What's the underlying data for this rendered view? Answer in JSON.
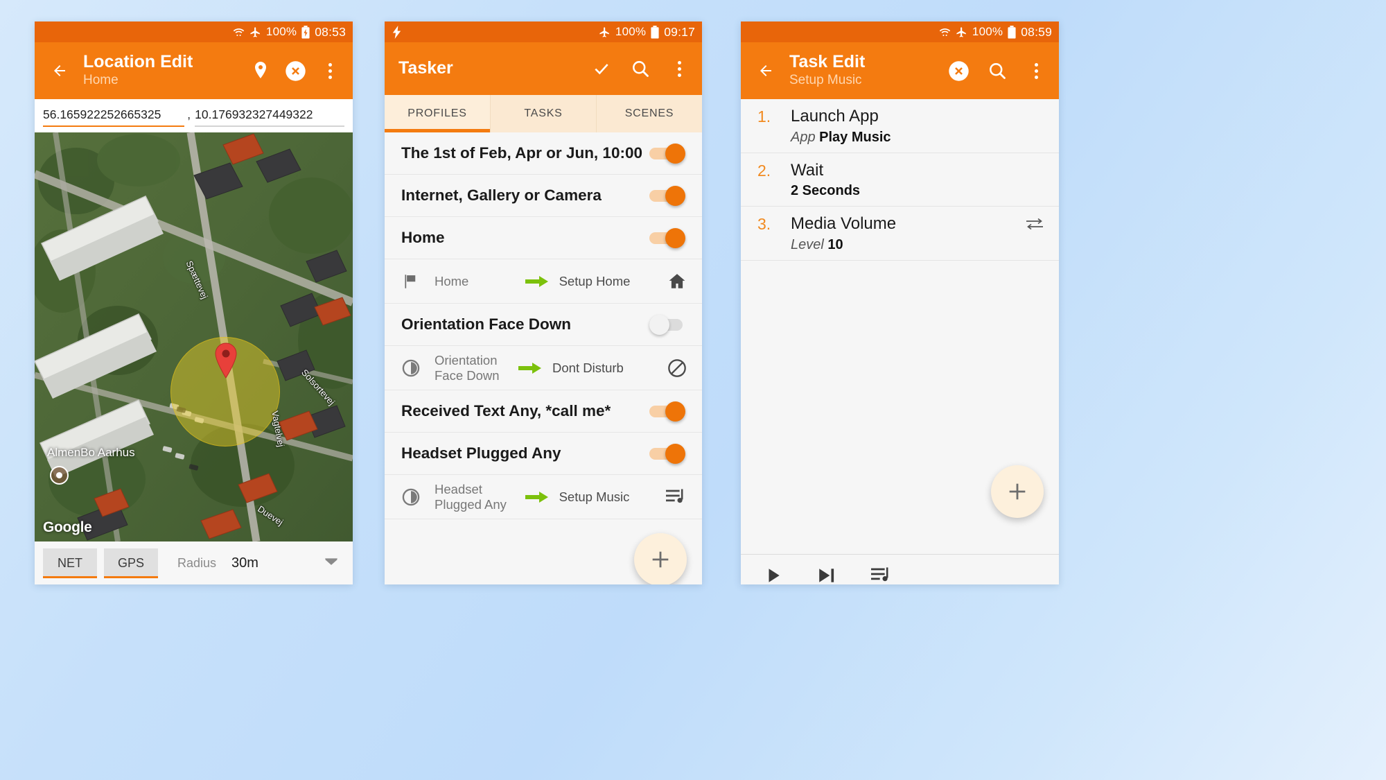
{
  "background": {
    "color_from": "#d6e9fb",
    "color_to": "#e4f0fd"
  },
  "theme": {
    "accent": "#f47b10",
    "statusbar": "#e8650a",
    "tabbar": "#fbe9d2",
    "green_arrow": "#7cc10c",
    "number_orange": "#f18a20"
  },
  "phone1": {
    "status": {
      "battery_pct": "100%",
      "time": "08:53",
      "icons": [
        "wifi-icon",
        "airplane-icon",
        "battery-charging-icon"
      ]
    },
    "appbar": {
      "title": "Location Edit",
      "subtitle": "Home",
      "back_icon": "arrow-back-icon",
      "actions": [
        "map-pin-icon",
        "close-circle-icon",
        "overflow-menu-icon"
      ]
    },
    "coords": {
      "latitude": "56.165922252665325",
      "separator": ",",
      "longitude": "10.176932327449322"
    },
    "map": {
      "attribution": "Google",
      "place_label": "AlmenBo Aarhus",
      "street_labels": [
        "Spættevej",
        "Solsortevej",
        "Vagtelvej",
        "Duevej"
      ]
    },
    "bottom": {
      "net_label": "NET",
      "gps_label": "GPS",
      "radius_label": "Radius",
      "radius_value": "30m",
      "caret_icon": "chevron-down-icon"
    }
  },
  "phone2": {
    "status": {
      "battery_pct": "100%",
      "time": "09:17",
      "left_icons": [
        "flash-icon"
      ],
      "icons": [
        "airplane-icon",
        "battery-icon"
      ]
    },
    "appbar": {
      "title": "Tasker",
      "actions": [
        "check-icon",
        "search-icon",
        "overflow-menu-icon"
      ]
    },
    "tabs": [
      {
        "label": "PROFILES",
        "active": true
      },
      {
        "label": "TASKS",
        "active": false
      },
      {
        "label": "SCENES",
        "active": false
      }
    ],
    "profiles": [
      {
        "name": "The 1st of Feb, Apr or Jun, 10:00",
        "enabled": true,
        "children": []
      },
      {
        "name": "Internet, Gallery or Camera",
        "enabled": true,
        "children": []
      },
      {
        "name": "Home",
        "enabled": true,
        "children": [
          {
            "context_icon": "flag-icon",
            "context": "Home",
            "arrow_icon": "arrow-right-icon",
            "task": "Setup Home",
            "task_icon": "home-icon"
          }
        ]
      },
      {
        "name": "Orientation Face Down",
        "enabled": false,
        "children": [
          {
            "context_icon": "orientation-icon",
            "context": "Orientation Face Down",
            "arrow_icon": "arrow-right-icon",
            "task": "Dont Disturb",
            "task_icon": "do-not-disturb-icon"
          }
        ]
      },
      {
        "name": "Received Text Any, *call me*",
        "enabled": true,
        "children": []
      },
      {
        "name": "Headset Plugged Any",
        "enabled": true,
        "children": [
          {
            "context_icon": "orientation-icon",
            "context": "Headset Plugged Any",
            "arrow_icon": "arrow-right-icon",
            "task": "Setup Music",
            "task_icon": "playlist-icon"
          }
        ]
      }
    ],
    "fab": {
      "icon": "plus-icon"
    }
  },
  "phone3": {
    "status": {
      "battery_pct": "100%",
      "time": "08:59",
      "icons": [
        "wifi-icon",
        "airplane-icon",
        "battery-icon"
      ]
    },
    "appbar": {
      "title": "Task Edit",
      "subtitle": "Setup Music",
      "back_icon": "arrow-back-icon",
      "actions": [
        "close-circle-icon",
        "search-icon",
        "overflow-menu-icon"
      ]
    },
    "actions": [
      {
        "num": "1.",
        "title": "Launch App",
        "sub_label": "App",
        "sub_value": "Play Music",
        "right_icon": ""
      },
      {
        "num": "2.",
        "title": "Wait",
        "sub_label": "",
        "sub_value": "2 Seconds",
        "right_icon": ""
      },
      {
        "num": "3.",
        "title": "Media Volume",
        "sub_label": "Level",
        "sub_value": "10",
        "right_icon": "swap-icon"
      }
    ],
    "fab": {
      "icon": "plus-icon"
    },
    "playbar": {
      "buttons": [
        "play-icon",
        "step-forward-icon",
        "playlist-icon"
      ]
    }
  }
}
